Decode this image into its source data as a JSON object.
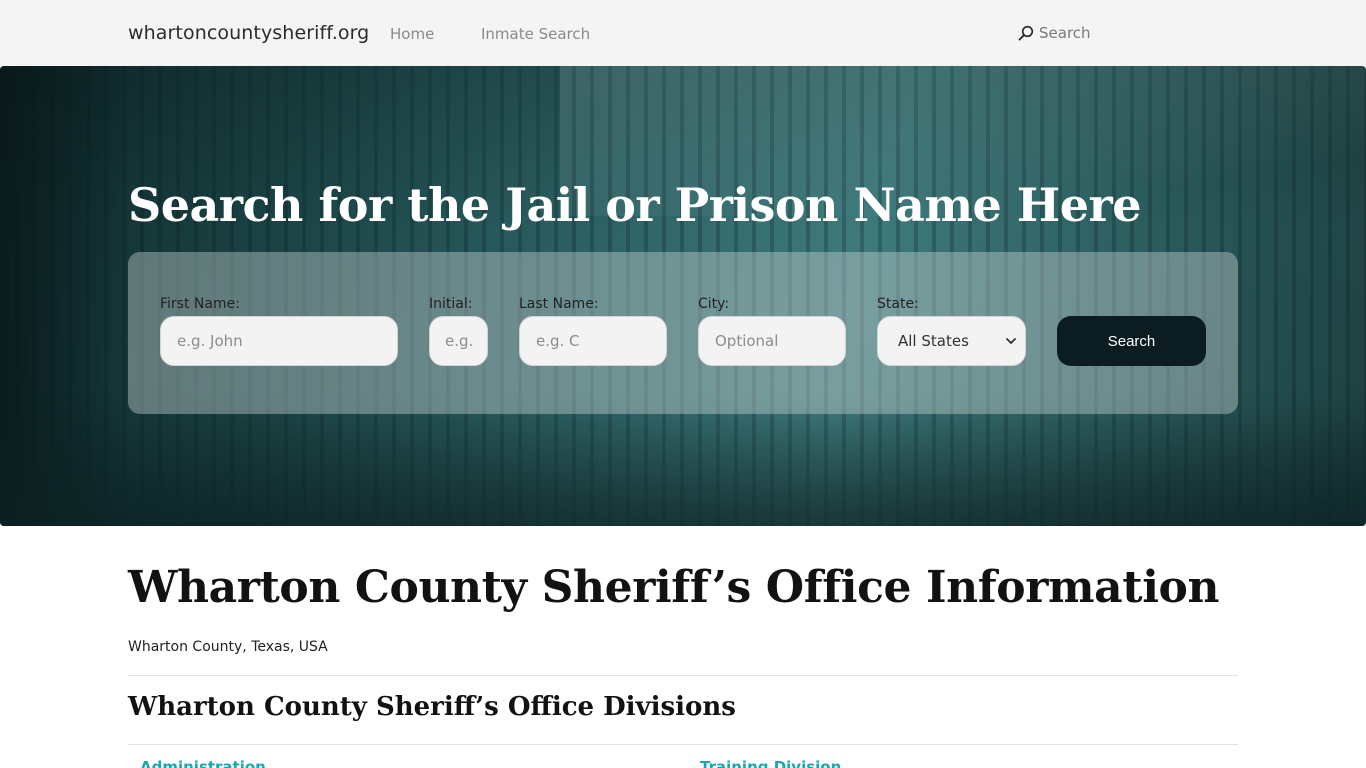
{
  "navbar": {
    "brand": "whartoncountysheriff.org",
    "links": [
      {
        "label": "Home"
      },
      {
        "label": "Inmate Search"
      }
    ],
    "search_label": "Search"
  },
  "hero": {
    "title": "Search for the Jail or Prison Name Here",
    "form": {
      "first_name": {
        "label": "First Name:",
        "placeholder": "e.g. John"
      },
      "initial": {
        "label": "Initial:",
        "placeholder": "e.g."
      },
      "last_name": {
        "label": "Last Name:",
        "placeholder": "e.g. C"
      },
      "city": {
        "label": "City:",
        "placeholder": "Optional"
      },
      "state": {
        "label": "State:",
        "selected": "All States"
      },
      "submit_label": "Search"
    }
  },
  "content": {
    "title": "Wharton County Sheriff’s Office Information",
    "subtitle": "Wharton County, Texas, USA",
    "section_title": "Wharton County Sheriff’s Office Divisions",
    "divisions": [
      {
        "label": "Administration"
      },
      {
        "label": "Training Division"
      }
    ]
  },
  "colors": {
    "navbar_bg": "#f4f4f4",
    "button_bg": "#0b1d20",
    "link_accent": "#1aa6b7"
  }
}
